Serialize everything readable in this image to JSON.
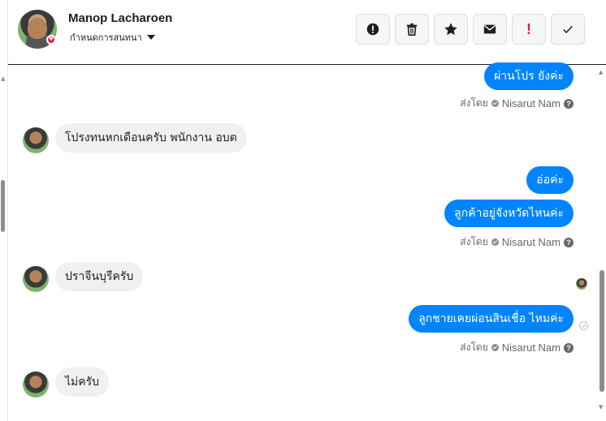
{
  "header": {
    "contact_name": "Manop Lacharoen",
    "label_dropdown": "กำหนดการสนทนา",
    "actions": [
      {
        "name": "spam",
        "icon": "alert-circle-icon"
      },
      {
        "name": "delete",
        "icon": "trash-icon"
      },
      {
        "name": "star",
        "icon": "star-icon"
      },
      {
        "name": "mark-unread",
        "icon": "envelope-icon"
      },
      {
        "name": "follow-up",
        "icon": "exclamation-icon",
        "text": "!"
      },
      {
        "name": "done",
        "icon": "check-icon"
      }
    ]
  },
  "messages": [
    {
      "dir": "out",
      "text": "ผ่านโปร ยังค่ะ"
    },
    {
      "dir": "in",
      "text": "โปรงทนหกเดือนครับ  พนักงาน อบต"
    },
    {
      "dir": "out",
      "text": "อ่อค่ะ"
    },
    {
      "dir": "out",
      "text": "ลูกค้าอยู่จังหวัดไหนค่ะ"
    },
    {
      "dir": "in",
      "text": "ปราจีนบุรีครับ"
    },
    {
      "dir": "out",
      "text": "ลูกชายเคยผ่อนสินเชื่อ ไหมค่ะ"
    },
    {
      "dir": "in",
      "text": "ไม่ครับ"
    }
  ],
  "sent_by": {
    "prefix": "ส่งโดย",
    "agent": "Nisarut Nam",
    "help": "?"
  },
  "colors": {
    "outgoing_bubble": "#0084ff",
    "incoming_bubble": "#f0f0f0",
    "follow_up_red": "#e41e3f"
  }
}
